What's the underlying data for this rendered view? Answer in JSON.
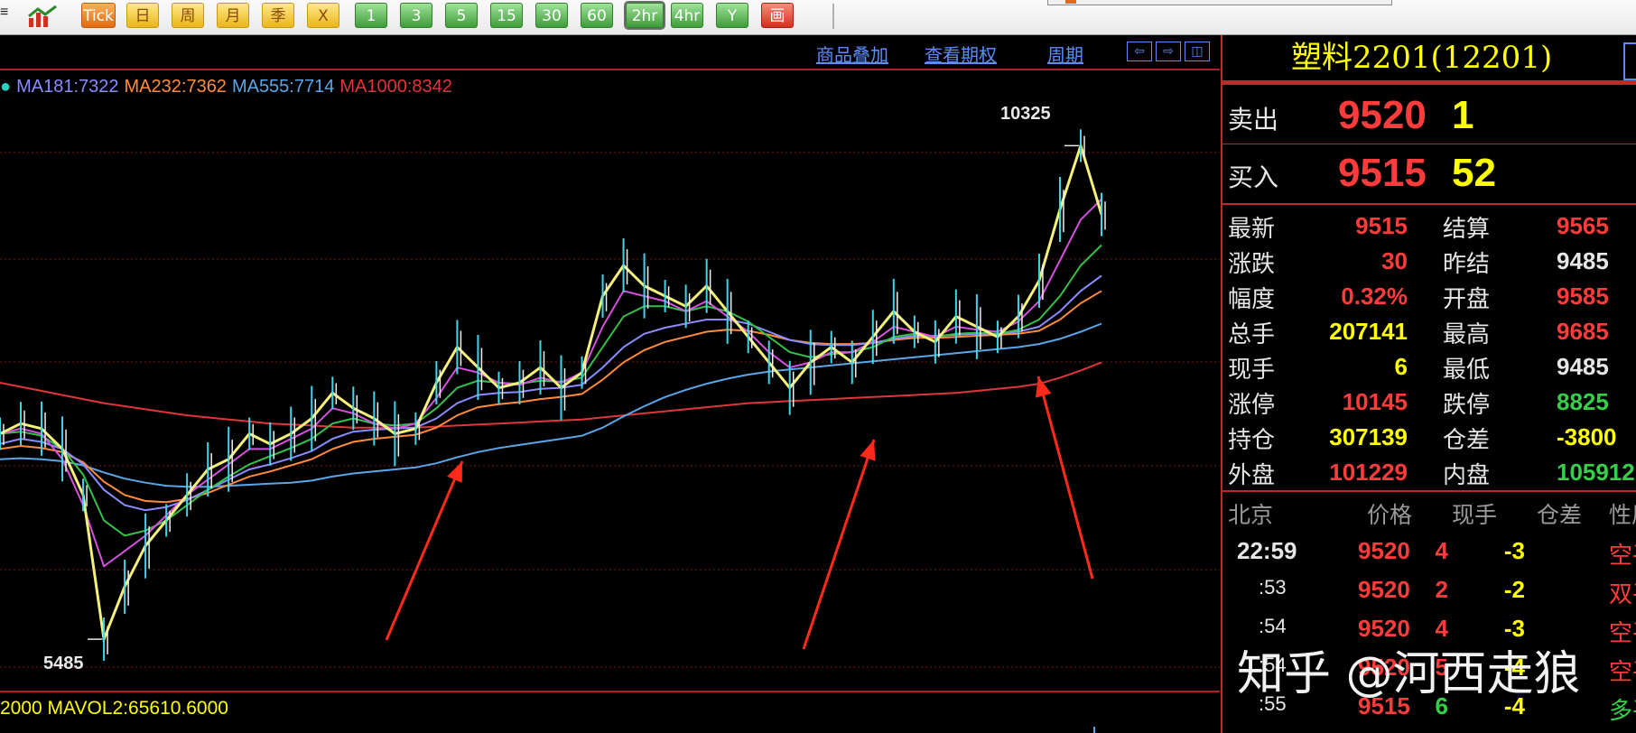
{
  "toolbar": {
    "buttons": [
      {
        "label": "Tick",
        "style": "orange"
      },
      {
        "label": "日",
        "style": "yellow"
      },
      {
        "label": "周",
        "style": "yellow"
      },
      {
        "label": "月",
        "style": "yellow"
      },
      {
        "label": "季",
        "style": "yellow"
      },
      {
        "label": "X",
        "style": "yellow"
      },
      {
        "label": "1",
        "style": "green"
      },
      {
        "label": "3",
        "style": "green"
      },
      {
        "label": "5",
        "style": "green"
      },
      {
        "label": "15",
        "style": "green"
      },
      {
        "label": "30",
        "style": "green"
      },
      {
        "label": "60",
        "style": "green"
      },
      {
        "label": "2hr",
        "style": "green",
        "selected": true
      },
      {
        "label": "4hr",
        "style": "green"
      },
      {
        "label": "Y",
        "style": "green"
      },
      {
        "label": "画",
        "style": "red"
      }
    ]
  },
  "chart_header": {
    "link_overlay": "商品叠加",
    "link_options": "查看期权",
    "link_period": "周期",
    "nav": [
      "⇦",
      "⇨",
      "◫"
    ]
  },
  "ma_legend": [
    {
      "label": "MA181:7322",
      "color": "#8a8cff"
    },
    {
      "label": "MA232:7362",
      "color": "#ff8c3a"
    },
    {
      "label": "MA555:7714",
      "color": "#5aa6e8"
    },
    {
      "label": "MA1000:8342",
      "color": "#e0353a"
    }
  ],
  "vol_legend": "2000  MAVOL2:65610.6000",
  "annotations": {
    "high_label": "10325",
    "low_label": "5485"
  },
  "chart_data": {
    "type": "line",
    "title": "",
    "xlabel": "",
    "ylabel": "",
    "ylim": [
      5300,
      10700
    ],
    "grid": "horizontal dotted red",
    "x": [
      0,
      1,
      2,
      3,
      4,
      5,
      6,
      7,
      8,
      9,
      10,
      11,
      12,
      13,
      14,
      15,
      16,
      17,
      18,
      19,
      20,
      21,
      22,
      23,
      24,
      25,
      26,
      27,
      28,
      29,
      30,
      31,
      32,
      33,
      34,
      35,
      36,
      37,
      38,
      39,
      40,
      41,
      42,
      43,
      44,
      45,
      46,
      47,
      48,
      49,
      50,
      51,
      52,
      53
    ],
    "series": [
      {
        "name": "price",
        "color": "#f5f07a",
        "values": [
          7500,
          7600,
          7550,
          7350,
          6900,
          5485,
          6000,
          6400,
          6650,
          6900,
          7150,
          7250,
          7500,
          7400,
          7500,
          7650,
          7900,
          7750,
          7650,
          7500,
          7550,
          8000,
          8350,
          8150,
          7950,
          8000,
          8150,
          7950,
          8100,
          8850,
          9150,
          8950,
          8850,
          8750,
          8950,
          8700,
          8450,
          8200,
          7950,
          8200,
          8350,
          8200,
          8450,
          8700,
          8500,
          8400,
          8650,
          8550,
          8450,
          8650,
          9000,
          9700,
          10325,
          9650
        ]
      },
      {
        "name": "fast",
        "color": "#d850e0",
        "values": [
          7500,
          7550,
          7500,
          7250,
          6800,
          6200,
          6350,
          6500,
          6700,
          6900,
          7050,
          7200,
          7350,
          7350,
          7450,
          7550,
          7750,
          7700,
          7600,
          7550,
          7600,
          7850,
          8150,
          8100,
          8000,
          7980,
          8050,
          8000,
          8100,
          8550,
          8900,
          8850,
          8800,
          8700,
          8800,
          8650,
          8500,
          8300,
          8150,
          8200,
          8300,
          8300,
          8400,
          8550,
          8500,
          8450,
          8550,
          8520,
          8500,
          8600,
          8800,
          9200,
          9600,
          9800
        ]
      },
      {
        "name": "green",
        "color": "#35c04a",
        "values": [
          7500,
          7520,
          7480,
          7350,
          7100,
          6650,
          6500,
          6550,
          6650,
          6800,
          6950,
          7080,
          7200,
          7280,
          7360,
          7450,
          7600,
          7650,
          7600,
          7580,
          7600,
          7750,
          7950,
          8020,
          8000,
          7990,
          8020,
          8010,
          8050,
          8350,
          8650,
          8750,
          8750,
          8700,
          8750,
          8700,
          8600,
          8450,
          8300,
          8250,
          8280,
          8300,
          8350,
          8450,
          8480,
          8450,
          8480,
          8490,
          8480,
          8520,
          8620,
          8850,
          9150,
          9350
        ]
      },
      {
        "name": "MA181",
        "color": "#8a8cff",
        "values": [
          7400,
          7450,
          7420,
          7350,
          7200,
          6950,
          6800,
          6750,
          6780,
          6850,
          6950,
          7050,
          7150,
          7200,
          7260,
          7330,
          7450,
          7520,
          7540,
          7550,
          7560,
          7650,
          7800,
          7880,
          7900,
          7910,
          7940,
          7950,
          7980,
          8150,
          8350,
          8480,
          8540,
          8580,
          8620,
          8620,
          8580,
          8500,
          8420,
          8380,
          8370,
          8370,
          8390,
          8430,
          8460,
          8460,
          8470,
          8480,
          8480,
          8500,
          8550,
          8700,
          8900,
          9050
        ]
      },
      {
        "name": "MA232",
        "color": "#ff8c3a",
        "values": [
          7350,
          7380,
          7360,
          7320,
          7220,
          7030,
          6900,
          6840,
          6830,
          6860,
          6920,
          7000,
          7080,
          7130,
          7190,
          7250,
          7350,
          7420,
          7450,
          7470,
          7490,
          7560,
          7680,
          7760,
          7790,
          7810,
          7840,
          7860,
          7890,
          8030,
          8200,
          8320,
          8400,
          8450,
          8500,
          8520,
          8510,
          8470,
          8420,
          8390,
          8380,
          8380,
          8390,
          8420,
          8440,
          8440,
          8450,
          8460,
          8470,
          8480,
          8510,
          8620,
          8780,
          8900
        ]
      },
      {
        "name": "MA555",
        "color": "#5aa6e8",
        "values": [
          7250,
          7260,
          7250,
          7230,
          7190,
          7120,
          7060,
          7020,
          6990,
          6980,
          6980,
          6990,
          7000,
          7010,
          7020,
          7040,
          7080,
          7110,
          7130,
          7150,
          7170,
          7210,
          7270,
          7320,
          7360,
          7390,
          7420,
          7450,
          7480,
          7560,
          7670,
          7770,
          7860,
          7930,
          7990,
          8040,
          8080,
          8110,
          8130,
          8150,
          8170,
          8190,
          8210,
          8230,
          8250,
          8270,
          8290,
          8310,
          8330,
          8350,
          8380,
          8430,
          8500,
          8580
        ]
      },
      {
        "name": "MA1000",
        "color": "#e0353a",
        "values": [
          8000,
          7960,
          7920,
          7880,
          7840,
          7800,
          7770,
          7740,
          7710,
          7680,
          7660,
          7640,
          7620,
          7600,
          7590,
          7580,
          7570,
          7560,
          7560,
          7560,
          7560,
          7570,
          7580,
          7590,
          7600,
          7610,
          7620,
          7630,
          7640,
          7660,
          7680,
          7700,
          7720,
          7740,
          7760,
          7780,
          7800,
          7810,
          7820,
          7830,
          7840,
          7850,
          7860,
          7870,
          7880,
          7890,
          7900,
          7920,
          7940,
          7960,
          7990,
          8050,
          8120,
          8200
        ]
      }
    ]
  },
  "quote": {
    "title": "塑料2201(12201)",
    "sell": {
      "label": "卖出",
      "price": "9520",
      "qty": "1"
    },
    "buy": {
      "label": "买入",
      "price": "9515",
      "qty": "52"
    },
    "stats": [
      {
        "l1": "最新",
        "v1": "9515",
        "c1": "#ff3b3b",
        "l2": "结算",
        "v2": "9565",
        "c2": "#ff3b3b"
      },
      {
        "l1": "涨跌",
        "v1": "30",
        "c1": "#ff3b3b",
        "l2": "昨结",
        "v2": "9485",
        "c2": "#e6e6e6"
      },
      {
        "l1": "幅度",
        "v1": "0.32%",
        "c1": "#ff3b3b",
        "l2": "开盘",
        "v2": "9585",
        "c2": "#ff3b3b"
      },
      {
        "l1": "总手",
        "v1": "207141",
        "c1": "#ffff00",
        "l2": "最高",
        "v2": "9685",
        "c2": "#ff3b3b"
      },
      {
        "l1": "现手",
        "v1": "6",
        "c1": "#ffff00",
        "l2": "最低",
        "v2": "9485",
        "c2": "#e6e6e6"
      },
      {
        "l1": "涨停",
        "v1": "10145",
        "c1": "#ff3b3b",
        "l2": "跌停",
        "v2": "8825",
        "c2": "#35d04a"
      },
      {
        "l1": "持仓",
        "v1": "307139",
        "c1": "#ffff00",
        "l2": "仓差",
        "v2": "-3800",
        "c2": "#ffff00"
      },
      {
        "l1": "外盘",
        "v1": "101229",
        "c1": "#ff3b3b",
        "l2": "内盘",
        "v2": "105912",
        "c2": "#35d04a"
      }
    ],
    "tick_header": {
      "time": "北京",
      "price": "价格",
      "qty": "现手",
      "diff": "仓差",
      "nature": "性质"
    },
    "ticks": [
      {
        "time": "22:59",
        "price": "9520",
        "qty": "4",
        "qty_color": "#ff3b3b",
        "diff": "-3",
        "diff_color": "#ffff00",
        "nature": "空平",
        "nature_color": "#ff3b3b"
      },
      {
        "time": ":53",
        "price": "9520",
        "qty": "2",
        "qty_color": "#ff3b3b",
        "diff": "-2",
        "diff_color": "#ffff00",
        "nature": "双平",
        "nature_color": "#ff3b3b"
      },
      {
        "time": ":54",
        "price": "9520",
        "qty": "4",
        "qty_color": "#ff3b3b",
        "diff": "-3",
        "diff_color": "#ffff00",
        "nature": "空平",
        "nature_color": "#ff3b3b"
      },
      {
        "time": ":54",
        "price": "9520",
        "qty": "5",
        "qty_color": "#ff3b3b",
        "diff": "-4",
        "diff_color": "#ffff00",
        "nature": "空平",
        "nature_color": "#ff3b3b"
      },
      {
        "time": ":55",
        "price": "9515",
        "qty": "6",
        "qty_color": "#35d04a",
        "diff": "-4",
        "diff_color": "#ffff00",
        "nature": "多平",
        "nature_color": "#35d04a"
      }
    ]
  },
  "watermark": "知乎 @河西走狼"
}
